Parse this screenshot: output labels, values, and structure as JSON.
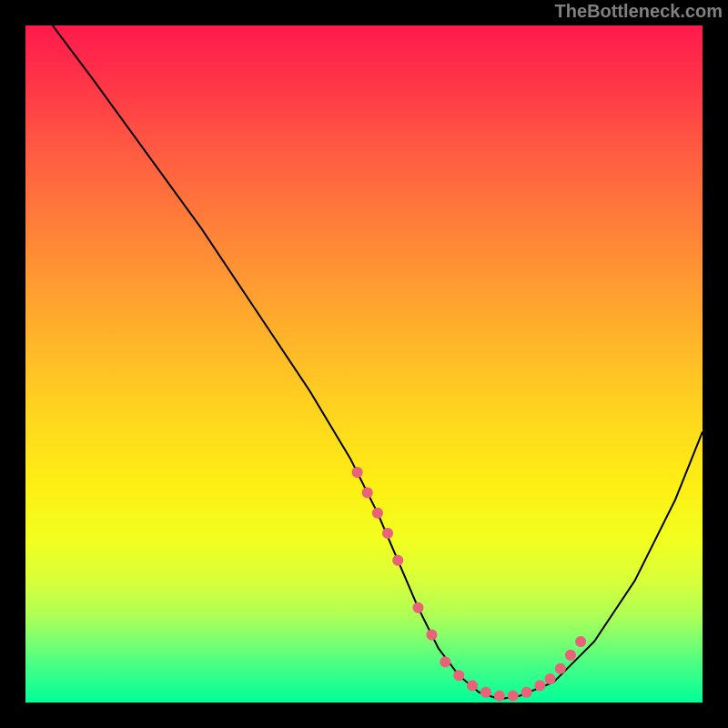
{
  "watermark": "TheBottleneck.com",
  "chart_data": {
    "type": "line",
    "title": "",
    "xlabel": "",
    "ylabel": "",
    "xlim": [
      0,
      100
    ],
    "ylim": [
      0,
      100
    ],
    "curve": {
      "x": [
        4,
        10,
        18,
        26,
        34,
        42,
        48,
        52,
        55,
        58,
        61,
        64,
        67,
        70,
        73,
        78,
        84,
        90,
        96,
        100
      ],
      "y": [
        100,
        92,
        81,
        70,
        58,
        46,
        36,
        28,
        21,
        14,
        8,
        4,
        1.5,
        0.5,
        1,
        3,
        9,
        18,
        30,
        40
      ]
    },
    "markers": {
      "x": [
        49,
        50.5,
        52,
        53.5,
        55,
        58,
        60,
        62,
        64,
        66,
        68,
        70,
        72,
        74,
        76,
        77.5,
        79,
        80.5,
        82
      ],
      "y": [
        34,
        31,
        28,
        25,
        21,
        14,
        10,
        6,
        4,
        2.5,
        1.5,
        1,
        1,
        1.5,
        2.5,
        3.5,
        5,
        7,
        9
      ]
    },
    "marker_color": "#e8637a",
    "curve_color": "#000000"
  }
}
